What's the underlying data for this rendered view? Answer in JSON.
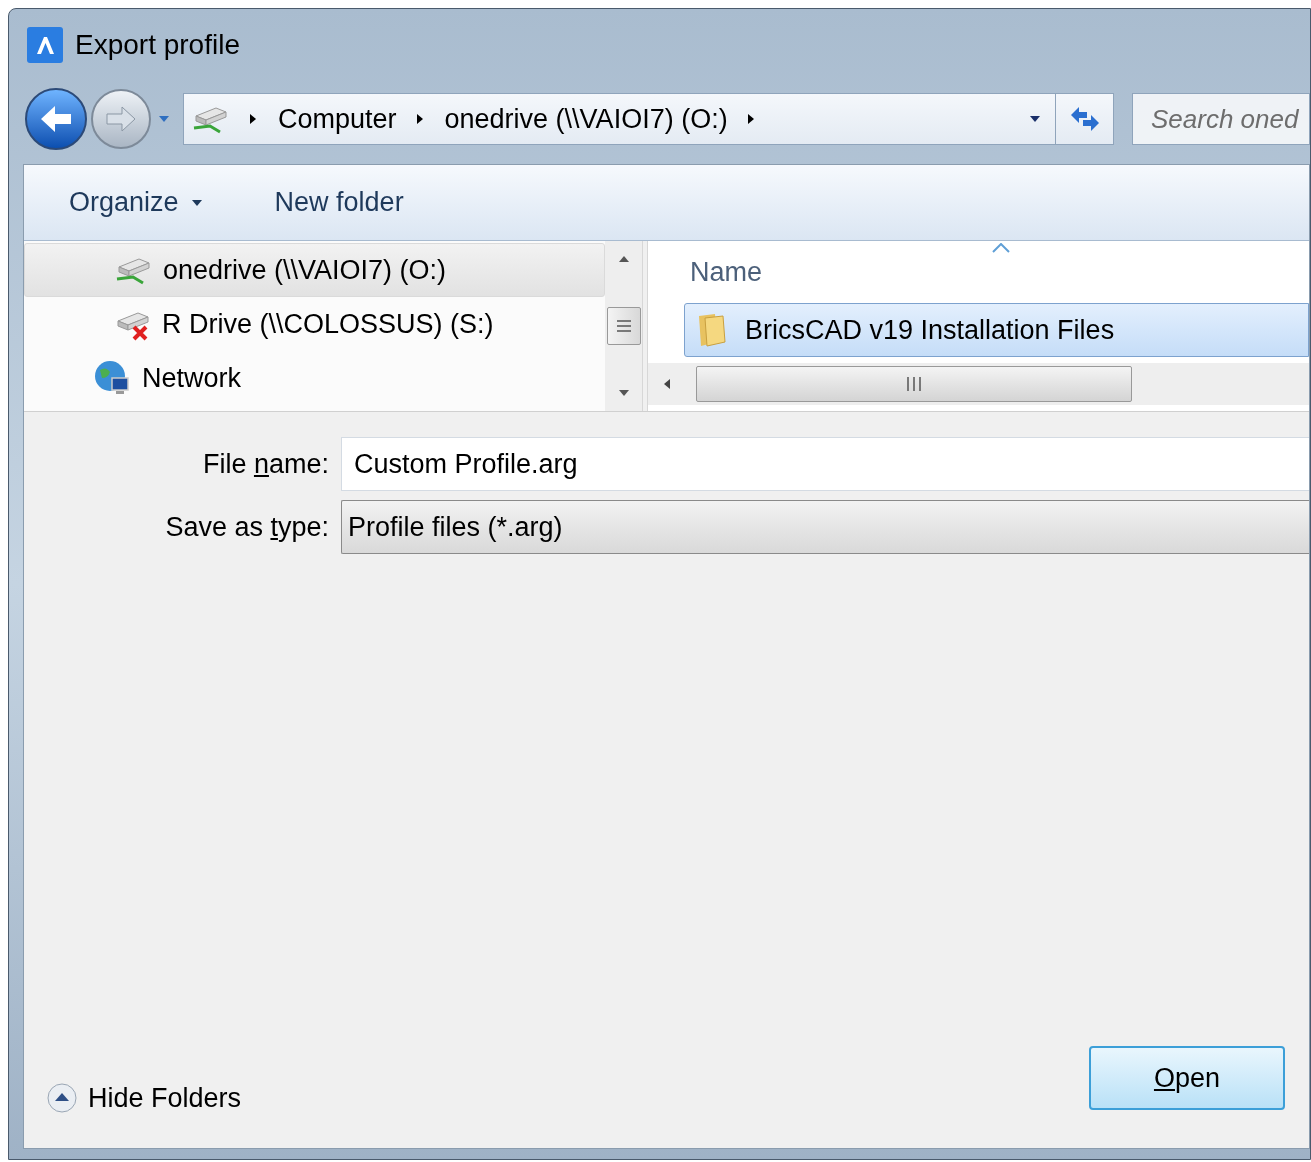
{
  "window": {
    "title": "Export profile"
  },
  "address_bar": {
    "crumbs": [
      "Computer",
      "onedrive (\\\\VAIOI7) (O:)"
    ]
  },
  "search": {
    "placeholder": "Search oned"
  },
  "toolbar": {
    "buttons": [
      {
        "label": "Organize",
        "kind": "menu"
      },
      {
        "label": "New folder",
        "kind": "plain"
      }
    ]
  },
  "nav_pane": {
    "items": [
      {
        "label": "onedrive (\\\\VAIOI7) (O:)",
        "kind": "drive",
        "selected": true
      },
      {
        "label": "R Drive (\\\\COLOSSUS) (S:)",
        "kind": "disconnected-drive",
        "selected": false
      },
      {
        "label": "Network",
        "kind": "network",
        "selected": false
      }
    ]
  },
  "file_list": {
    "columns": [
      {
        "label": "Name"
      }
    ],
    "rows": [
      {
        "name": "BricsCAD v19 Installation Files",
        "selected": true
      }
    ]
  },
  "form": {
    "fields": [
      {
        "label_parts": [
          "File ",
          "n",
          "ame:"
        ],
        "value": "Custom Profile.arg",
        "kind": "text"
      },
      {
        "label_parts": [
          "Save as ",
          "t",
          "ype:"
        ],
        "value": "Profile files (*.arg)",
        "kind": "select"
      }
    ]
  },
  "footer": {
    "toggle": "Hide Folders",
    "button": {
      "access_key": "O",
      "rest": "pen"
    }
  }
}
